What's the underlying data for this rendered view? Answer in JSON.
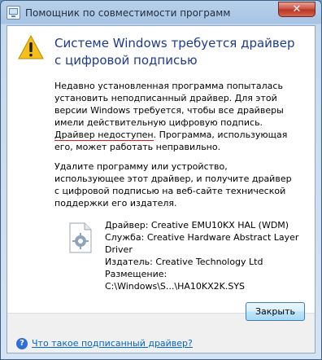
{
  "window": {
    "title": "Помощник по совместимости программ",
    "close_glyph": "✕",
    "accent": "#1e3a8a"
  },
  "dialog": {
    "heading": "Системе Windows требуется драйвер с цифровой подписью",
    "paragraph1_before": "Недавно установленная программа попыталась установить неподписанный драйвер. Для этой версии Windows требуется, чтобы все драйверы имели действительную цифровую подпись. ",
    "paragraph1_flagged": "Драйвер недоступен",
    "paragraph1_after": ". Программа, использующая его, может работать неправильно.",
    "paragraph2": "Удалите программу или устройство, использующее этот драйвер, и получите драйвер с цифровой подписью на веб-сайте технической поддержки его издателя.",
    "details": {
      "driver": "Драйвер: Creative EMU10KX HAL (WDM)",
      "service": "Служба: Creative Hardware Abstract Layer Driver",
      "publisher": "Издатель: Creative Technology Ltd",
      "location": "Размещение: C:\\Windows\\S...\\HA10KX2K.SYS"
    },
    "close_button": "Закрыть",
    "help_link": "Что такое подписанный драйвер?"
  },
  "icons": {
    "title": "program-compatibility-icon",
    "warning": "warning-icon",
    "file": "driver-file-icon",
    "help": "help-icon"
  },
  "colors": {
    "squiggle": "#d81b1b",
    "link": "#0066cc"
  }
}
